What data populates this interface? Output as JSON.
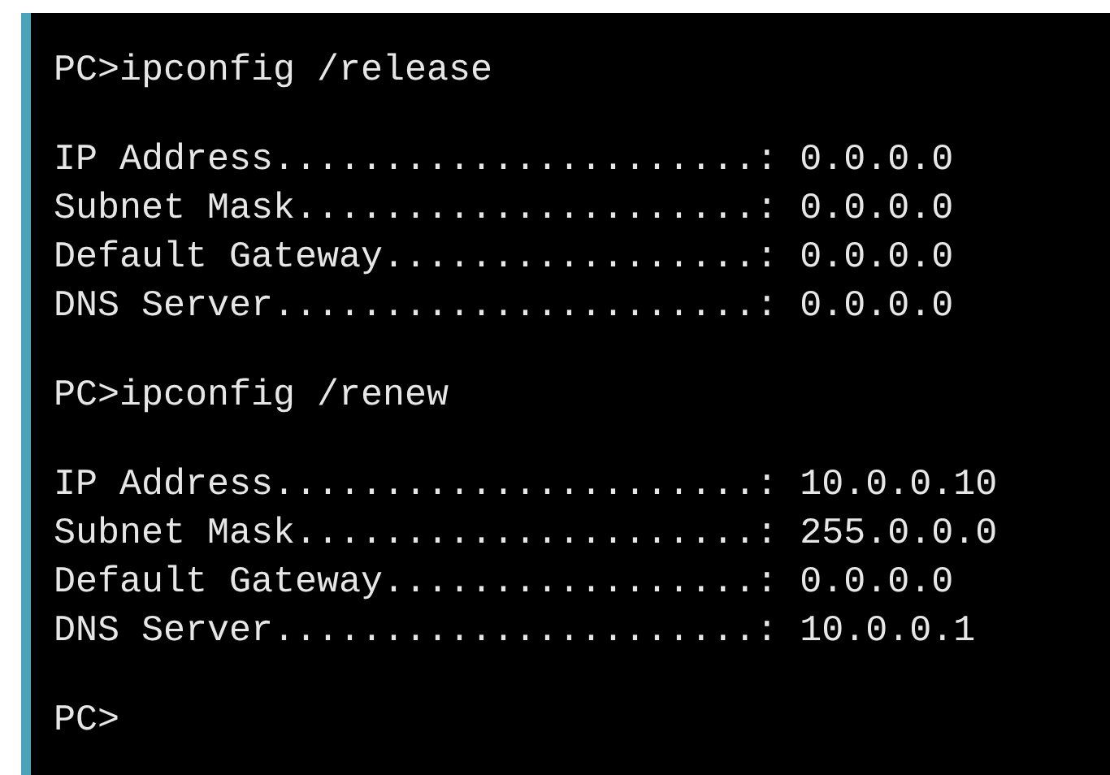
{
  "terminal": {
    "blocks": [
      [
        "PC>ipconfig /release"
      ],
      [
        "IP Address......................: 0.0.0.0",
        "Subnet Mask.....................: 0.0.0.0",
        "Default Gateway.................: 0.0.0.0",
        "DNS Server......................: 0.0.0.0"
      ],
      [
        "PC>ipconfig /renew"
      ],
      [
        "IP Address......................: 10.0.0.10",
        "Subnet Mask.....................: 255.0.0.0",
        "Default Gateway.................: 0.0.0.0",
        "DNS Server......................: 10.0.0.1"
      ],
      [
        "PC>"
      ]
    ]
  }
}
